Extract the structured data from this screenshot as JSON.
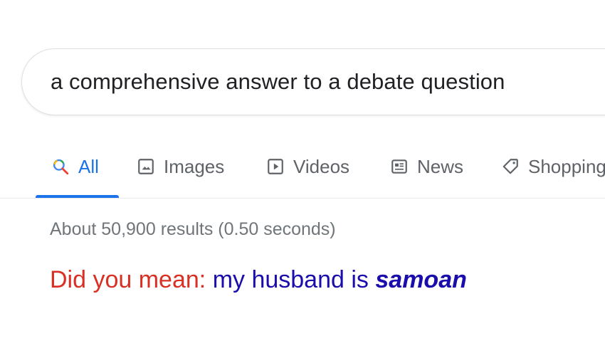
{
  "search": {
    "query": "a comprehensive answer to a debate question"
  },
  "tabs": [
    {
      "label": "All",
      "icon": "search-icon",
      "active": true
    },
    {
      "label": "Images",
      "icon": "image-icon",
      "active": false
    },
    {
      "label": "Videos",
      "icon": "play-icon",
      "active": false
    },
    {
      "label": "News",
      "icon": "newspaper-icon",
      "active": false
    },
    {
      "label": "Shopping",
      "icon": "tag-icon",
      "active": false
    }
  ],
  "results": {
    "stats": "About 50,900 results (0.50 seconds)"
  },
  "suggestion": {
    "label": "Did you mean:",
    "plain": "my husband is",
    "corrected": "samoan"
  },
  "colors": {
    "accent": "#1a73e8",
    "link": "#1a0dab",
    "suggestion_label": "#d93025",
    "muted": "#70757a"
  }
}
